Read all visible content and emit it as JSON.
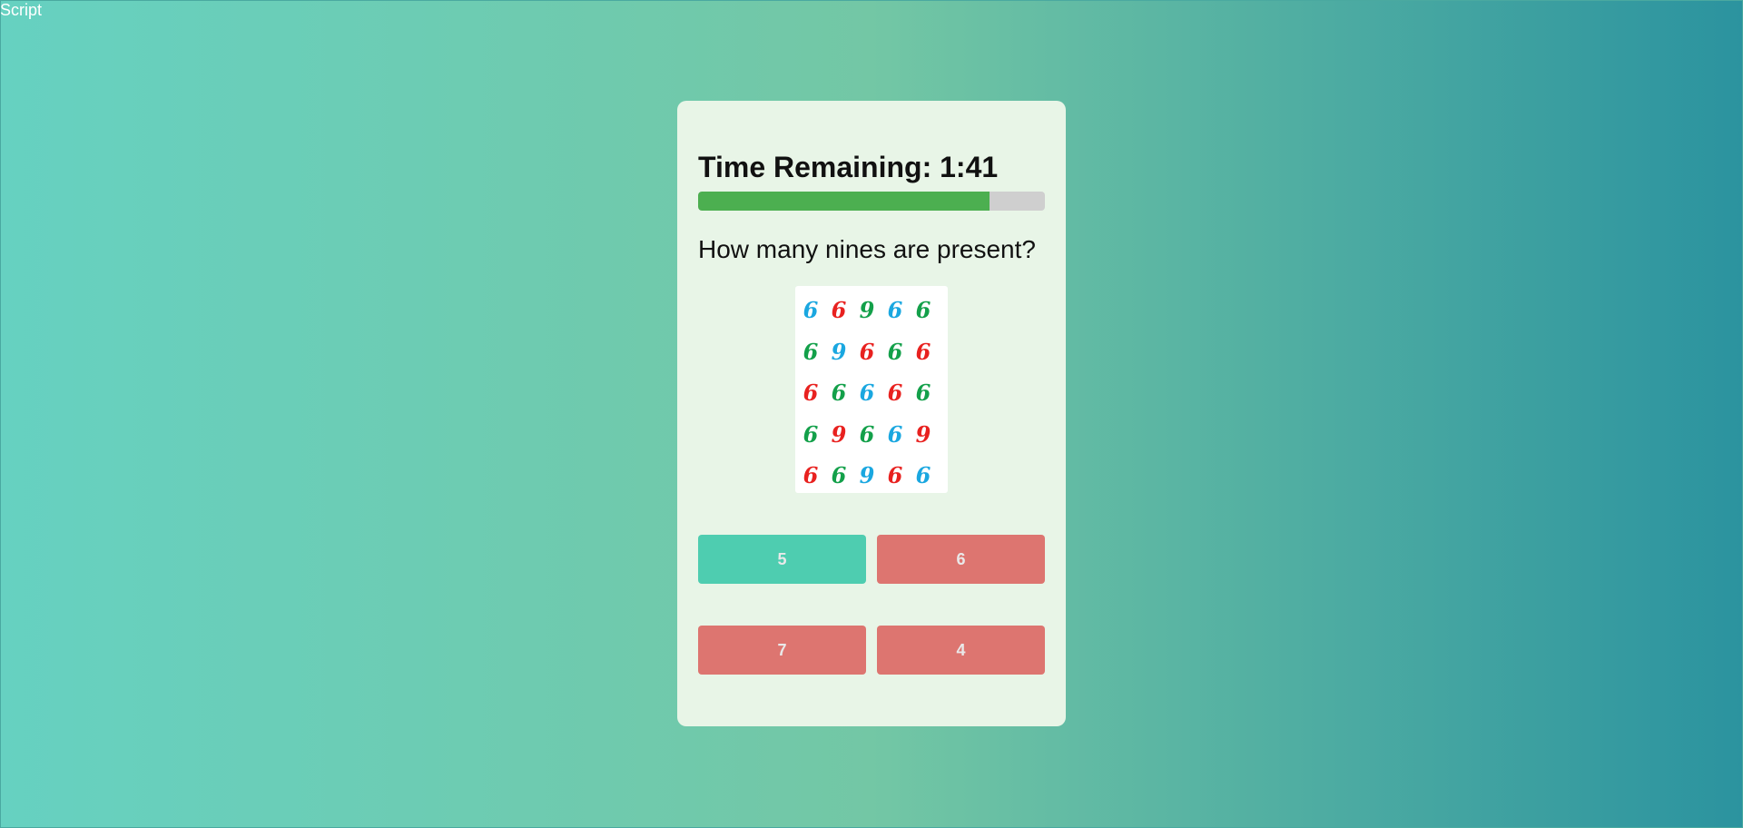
{
  "overlay": {
    "corner_text": "Script"
  },
  "game": {
    "timer_label": "Time Remaining: 1:41",
    "progress_fraction": 0.84,
    "question": "How many nines are present?",
    "grid": [
      [
        {
          "d": "6",
          "c": "#1aa7e0"
        },
        {
          "d": "6",
          "c": "#e8211f"
        },
        {
          "d": "9",
          "c": "#13a04a"
        },
        {
          "d": "6",
          "c": "#1aa7e0"
        },
        {
          "d": "6",
          "c": "#13a04a"
        }
      ],
      [
        {
          "d": "6",
          "c": "#13a04a"
        },
        {
          "d": "9",
          "c": "#1aa7e0"
        },
        {
          "d": "6",
          "c": "#e8211f"
        },
        {
          "d": "6",
          "c": "#13a04a"
        },
        {
          "d": "6",
          "c": "#e8211f"
        }
      ],
      [
        {
          "d": "6",
          "c": "#e8211f"
        },
        {
          "d": "6",
          "c": "#13a04a"
        },
        {
          "d": "6",
          "c": "#1aa7e0"
        },
        {
          "d": "6",
          "c": "#e8211f"
        },
        {
          "d": "6",
          "c": "#13a04a"
        }
      ],
      [
        {
          "d": "6",
          "c": "#13a04a"
        },
        {
          "d": "9",
          "c": "#e8211f"
        },
        {
          "d": "6",
          "c": "#13a04a"
        },
        {
          "d": "6",
          "c": "#1aa7e0"
        },
        {
          "d": "9",
          "c": "#e8211f"
        }
      ],
      [
        {
          "d": "6",
          "c": "#e8211f"
        },
        {
          "d": "6",
          "c": "#13a04a"
        },
        {
          "d": "9",
          "c": "#1aa7e0"
        },
        {
          "d": "6",
          "c": "#e8211f"
        },
        {
          "d": "6",
          "c": "#1aa7e0"
        }
      ]
    ],
    "answers": [
      {
        "label": "5",
        "color": "#4ecdb0"
      },
      {
        "label": "6",
        "color": "#dd7570"
      },
      {
        "label": "7",
        "color": "#dd7570"
      },
      {
        "label": "4",
        "color": "#dd7570"
      }
    ]
  }
}
